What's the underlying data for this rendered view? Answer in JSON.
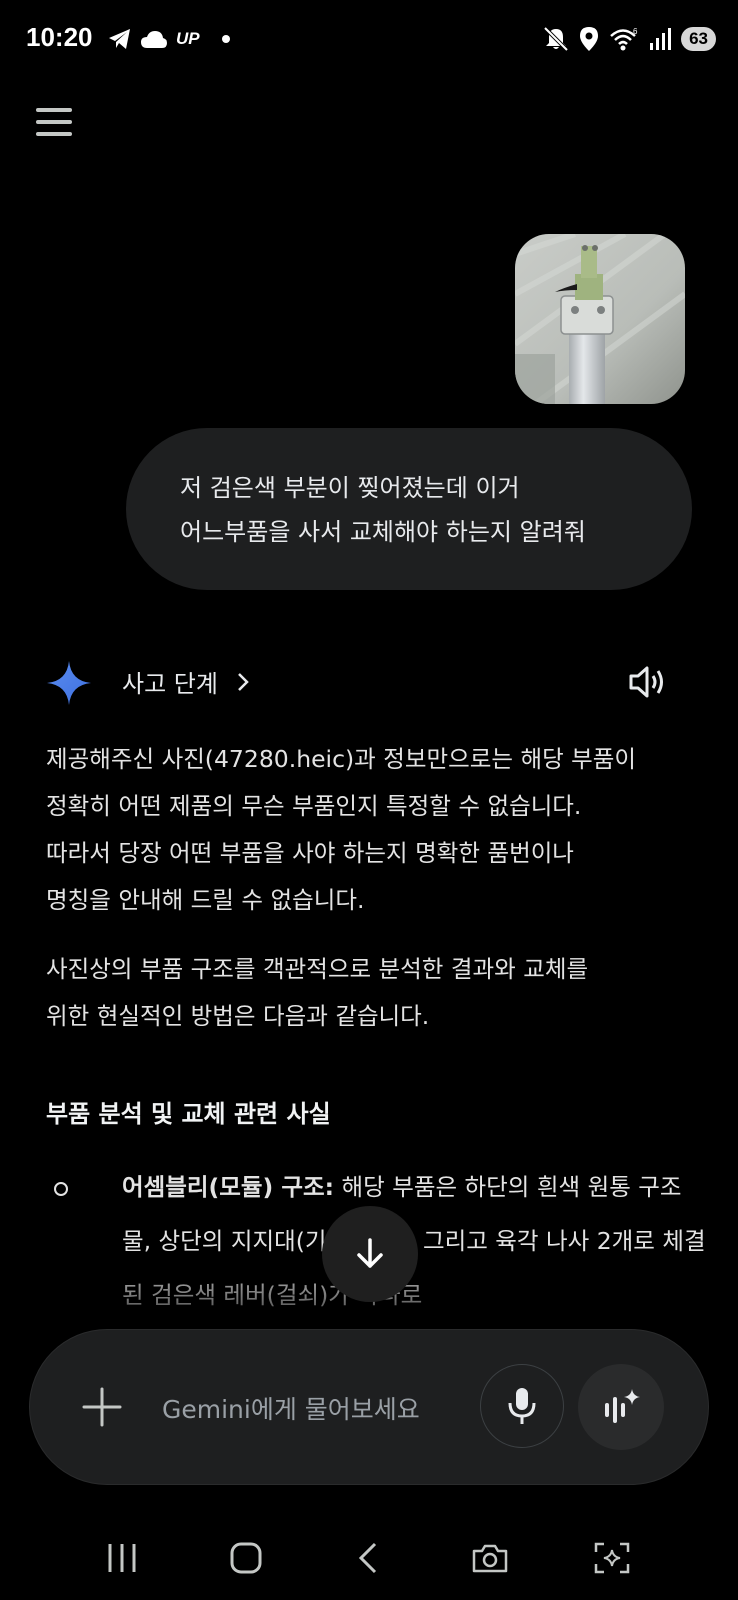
{
  "status_bar": {
    "time": "10:20",
    "up_label": "UP",
    "battery": "63"
  },
  "chat": {
    "user_message": "저 검은색 부분이 찢어졌는데 이거\n어느부품을 사서 교체해야 하는지 알려줘",
    "thinking_label": "사고 단계",
    "response_paragraphs": [
      "제공해주신 사진(47280.heic)과 정보만으로는 해당 부품이\n정확히 어떤 제품의 무슨 부품인지 특정할 수 없습니다.\n따라서 당장 어떤 부품을 사야 하는지 명확한 품번이나\n명칭을 안내해 드릴 수 없습니다.",
      "사진상의 부품 구조를 객관적으로 분석한 결과와 교체를\n위한 현실적인 방법은 다음과 같습니다."
    ],
    "section_heading": "부품 분석 및 교체 관련 사실",
    "bullet": {
      "bold": "어셈블리(모듈) 구조:",
      "text": " 해당 부품은 하단의 흰색 원통 구조물, 상단의 지지대(기판 추정), 그리고 육각 나사 2개로 체결된 검은색 레버(걸쇠)가 하나로"
    }
  },
  "input": {
    "placeholder": "Gemini에게 물어보세요"
  },
  "icons": {
    "menu": "hamburger-menu-icon",
    "gemini": "gemini-sparkle-icon",
    "speaker": "speaker-icon",
    "scroll": "arrow-down-icon",
    "plus": "plus-icon",
    "mic": "mic-icon",
    "live": "live-waveform-icon"
  },
  "colors": {
    "background": "#000000",
    "bubble": "#1e1f20",
    "gemini_blue": "#4285f4",
    "text": "#e3e3e3",
    "placeholder": "#9aa0a6"
  }
}
